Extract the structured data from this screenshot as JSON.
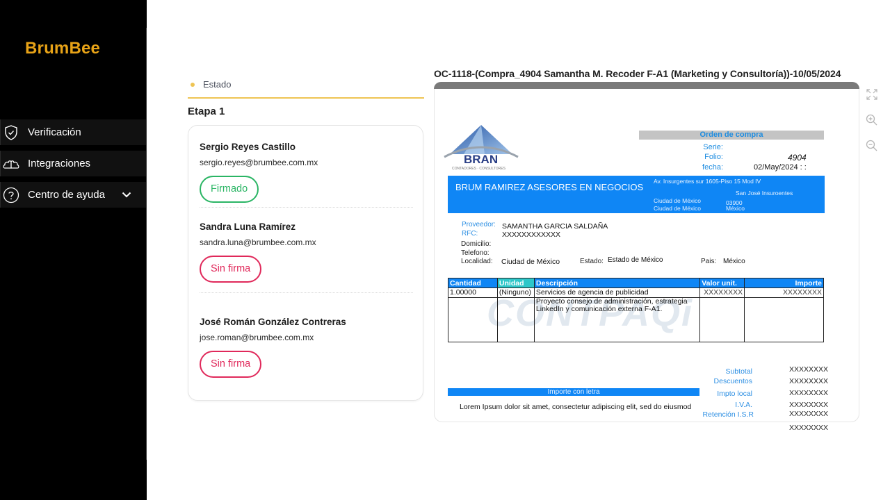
{
  "sidebar": {
    "logo": "BrumBee",
    "items": [
      {
        "label": "Verificación",
        "icon": "shield-check-icon"
      },
      {
        "label": "Integraciones",
        "icon": "cloud-sync-icon"
      },
      {
        "label": "Centro de ayuda",
        "icon": "help-circle-icon",
        "expandable": true
      }
    ]
  },
  "signers_panel": {
    "tab_label": "Estado",
    "stage_title": "Etapa 1",
    "signers": [
      {
        "name": "Sergio Reyes Castillo",
        "email": "sergio.reyes@brumbee.com.mx",
        "status": "Firmado",
        "status_color": "#2ab564"
      },
      {
        "name": "Sandra Luna Ramírez",
        "email": "sandra.luna@brumbee.com.mx",
        "status": "Sin firma",
        "status_color": "#e0285a"
      },
      {
        "name": "José Román González Contreras",
        "email": "jose.roman@brumbee.com.mx",
        "status": "Sin firma",
        "status_color": "#e0285a"
      }
    ]
  },
  "document": {
    "title": "OC-1118-(Compra_4904 Samantha M. Recoder F-A1 (Marketing y Consultoría))-10/05/2024",
    "tools": [
      "fullscreen-icon",
      "zoom-in-icon",
      "zoom-out-icon"
    ],
    "logo_name": "BRAN",
    "logo_tagline": "CONTADORES · CONSULTORES",
    "order_header": "Orden de compra",
    "serie_label": "Serie:",
    "serie_value": "",
    "folio_label": "Folio:",
    "folio_value": "4904",
    "fecha_label": "fecha:",
    "fecha_value": "02/May/2024  : :",
    "company": "BRUM RAMIREZ ASESORES EN NEGOCIOS",
    "address": {
      "street": "Av. Insurgentes sur 1605-Piso 15 Mod IV",
      "colony": "San José Insuroentes",
      "city1": "Ciudad de México",
      "city2": "Ciudad de México",
      "zip": "03900",
      "country": "México"
    },
    "provider": {
      "proveedor_label": "Proveedor:",
      "proveedor_value": "SAMANTHA GARCIA SALDAÑA",
      "rfc_label": "RFC:",
      "rfc_value": "XXXXXXXXXXXX",
      "domicilio_label": "Domicilio:",
      "telefono_label": "Telefono:",
      "localidad_label": "Localidad:",
      "localidad_value": "Ciudad de México",
      "estado_label": "Estado:",
      "estado_value": "Estado de México",
      "pais_label": "Pais:",
      "pais_value": "México"
    },
    "items_table": {
      "headers": [
        "Cantidad",
        "Unidad",
        "Descripción",
        "Valor unit.",
        "Importe"
      ],
      "rows": [
        [
          "1.00000",
          "(Ninguno)",
          "Servicios de agencia de publicidad",
          "XXXXXXXX",
          "XXXXXXXX"
        ],
        [
          "",
          "",
          "Proyecto consejo de administración, estrategia LinkedIn y comunicación externa F-A1.",
          "",
          ""
        ]
      ]
    },
    "watermark": "CONTPAQi",
    "importe_letra_label": "Importe con letra",
    "importe_letra_value": "Lorem Ipsum dolor sit amet, consectetur adipiscing elit, sed do eiusmod",
    "totals": [
      {
        "label": "Subtotal",
        "value": "XXXXXXXX"
      },
      {
        "label": "Descuentos",
        "value": "XXXXXXXX"
      },
      {
        "label": "Impto local",
        "value": "XXXXXXXX"
      },
      {
        "label": "I.V.A.",
        "value": "XXXXXXXX"
      },
      {
        "label": "Retención I.S.R",
        "value": "XXXXXXXX"
      },
      {
        "label": "",
        "value": "XXXXXXXX"
      }
    ]
  }
}
